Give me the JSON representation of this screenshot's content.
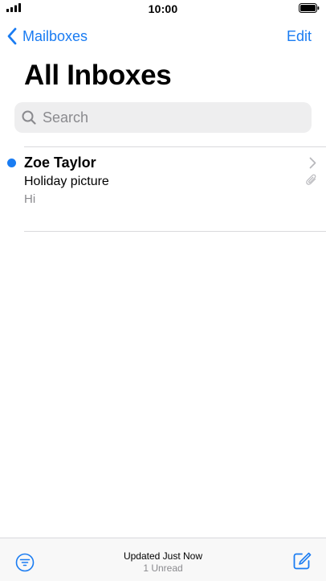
{
  "status_bar": {
    "time": "10:00"
  },
  "nav": {
    "back_label": "Mailboxes",
    "edit_label": "Edit",
    "title": "All Inboxes"
  },
  "search": {
    "placeholder": "Search",
    "value": ""
  },
  "messages": [
    {
      "sender": "Zoe Taylor",
      "subject": "Holiday picture",
      "preview": "Hi",
      "unread": true,
      "has_attachment": true
    }
  ],
  "toolbar": {
    "status": "Updated Just Now",
    "unread_count": "1 Unread"
  },
  "icons": {
    "signal": "signal-icon",
    "battery": "battery-icon",
    "back": "chevron-left-icon",
    "search": "search-icon",
    "chevron": "chevron-right-icon",
    "attachment": "paperclip-icon",
    "filter": "filter-icon",
    "compose": "compose-icon"
  },
  "colors": {
    "accent": "#1a7cf2",
    "secondary_text": "#8a8a8e",
    "search_background": "#eeeeef"
  }
}
